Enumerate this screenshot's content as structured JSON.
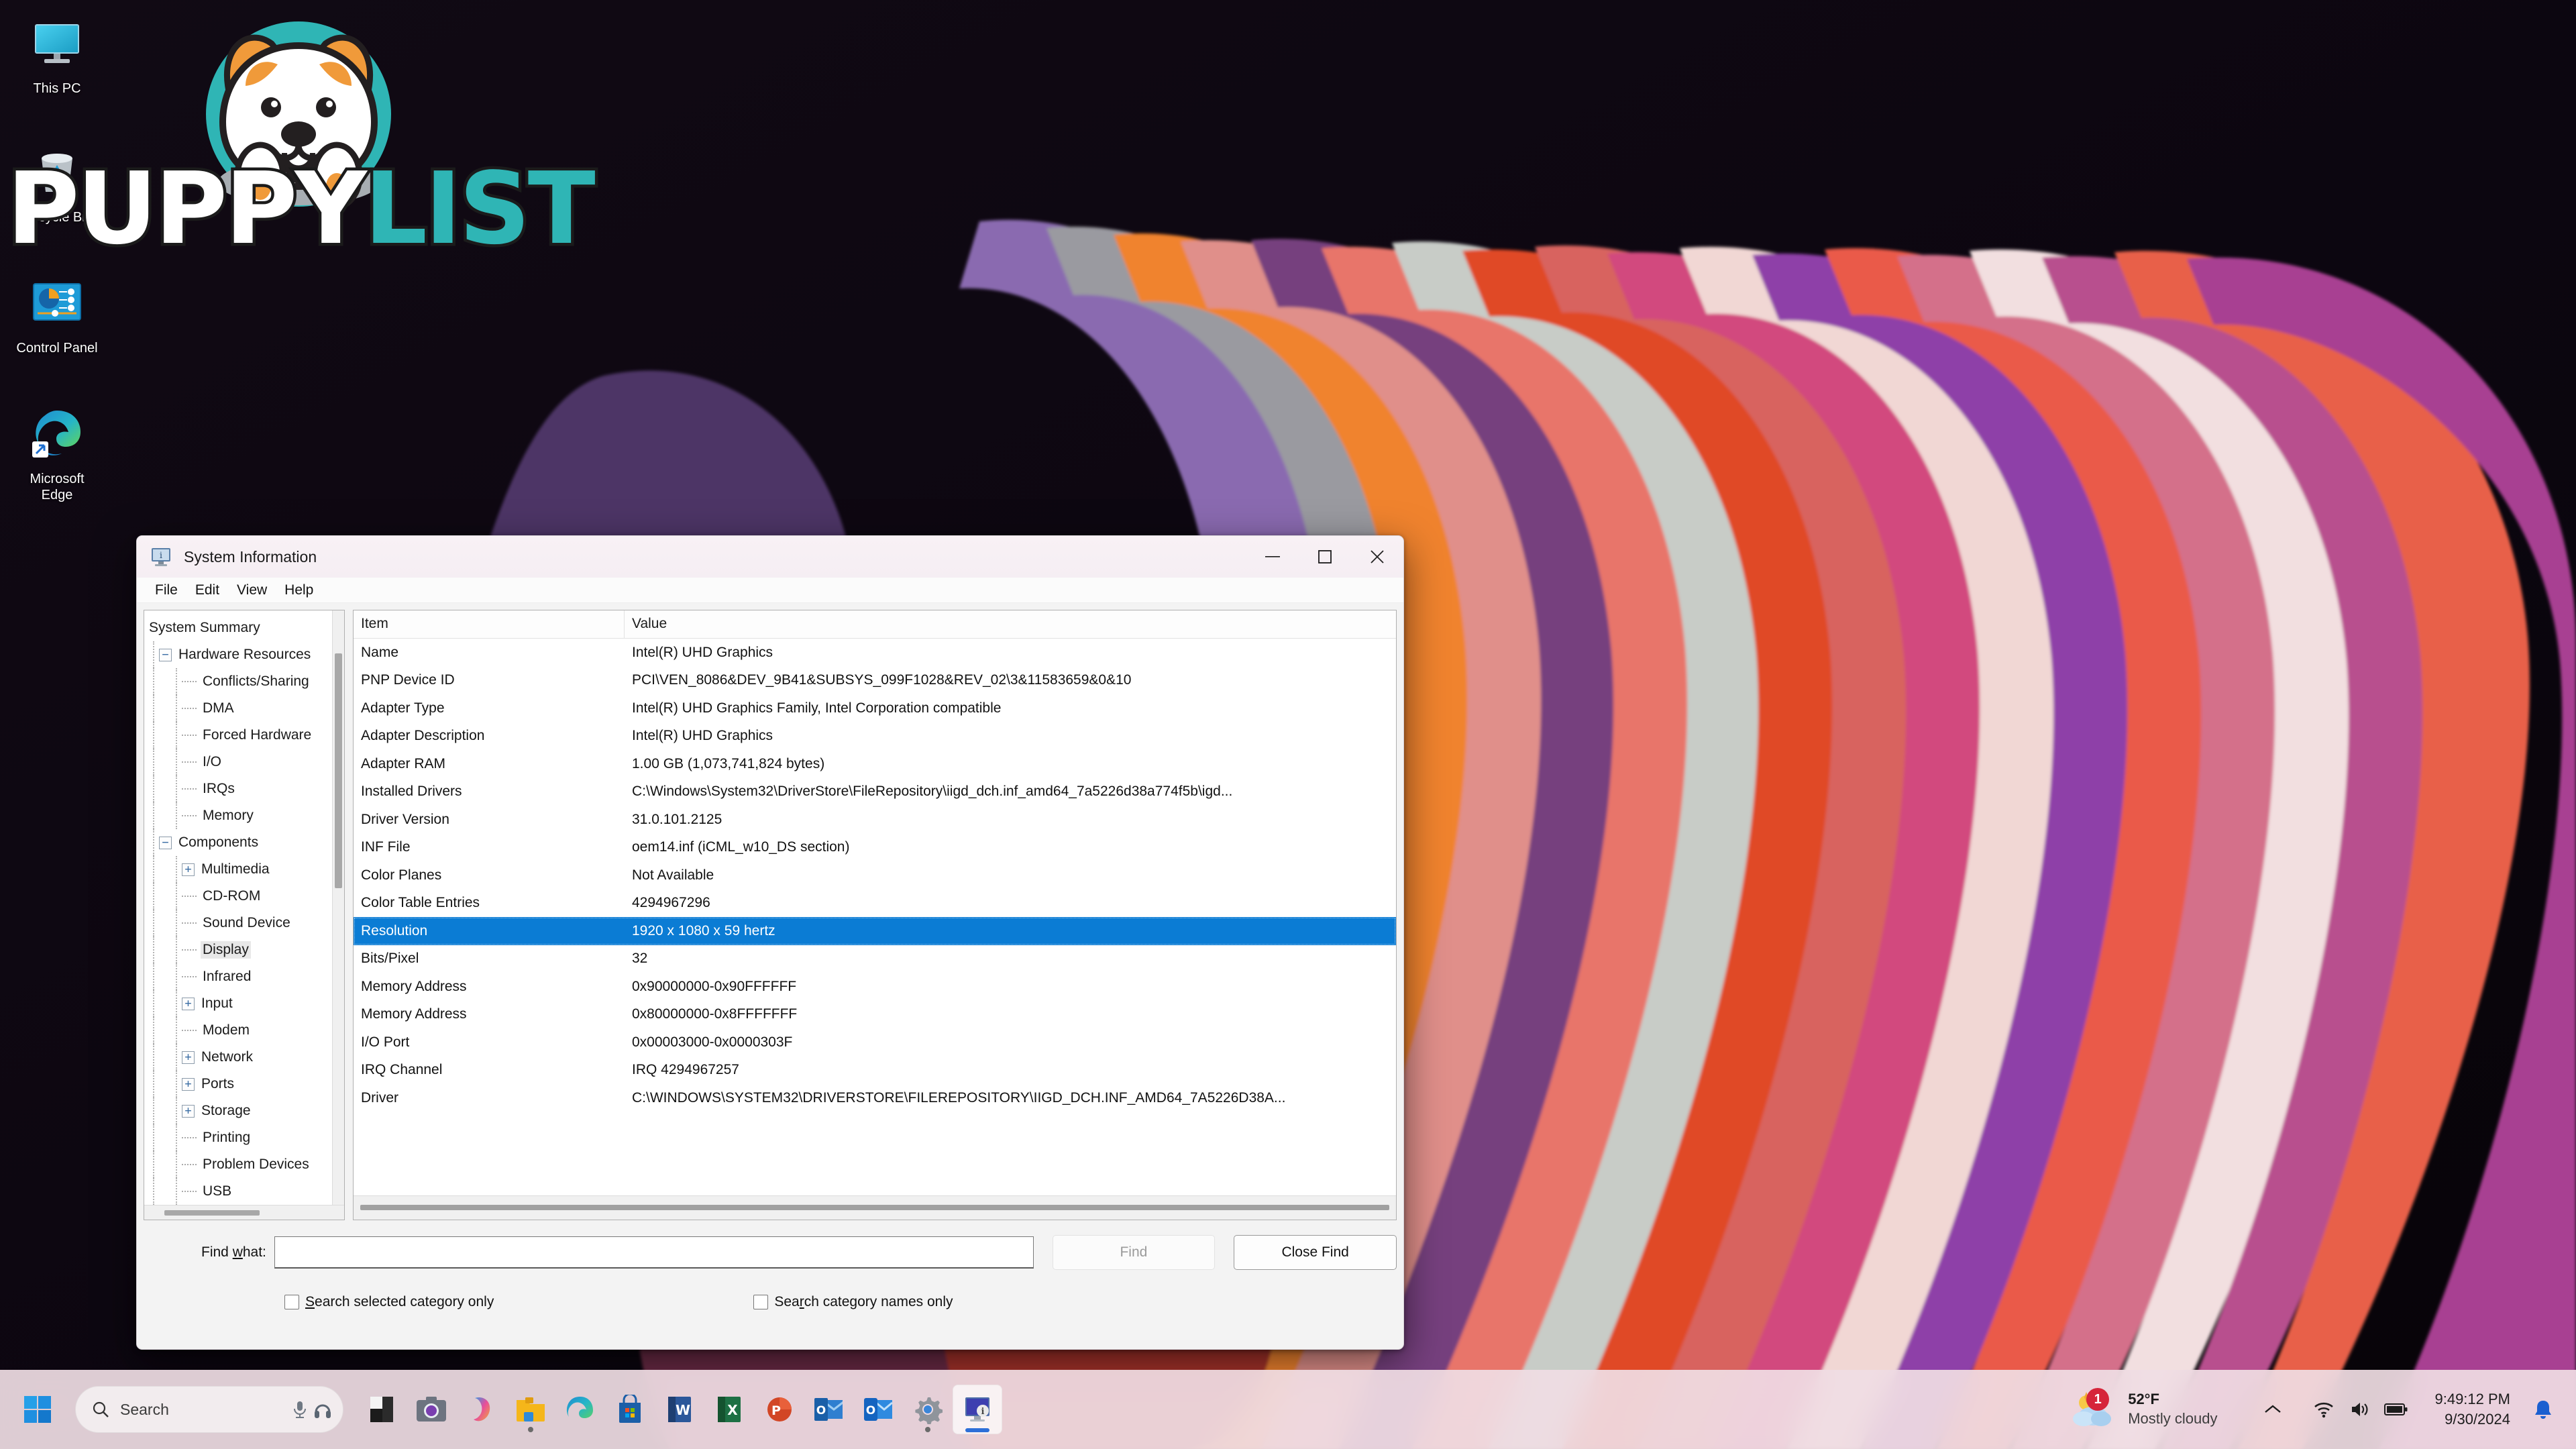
{
  "desktop": {
    "watermark": {
      "part1": "PUPPY",
      "part2": "LIST"
    },
    "icons": [
      {
        "name": "this-pc",
        "label": "This PC"
      },
      {
        "name": "recycle-bin",
        "label": "Recycle Bin"
      },
      {
        "name": "control-panel",
        "label": "Control Panel"
      },
      {
        "name": "microsoft-edge",
        "label": "Microsoft\nEdge"
      }
    ]
  },
  "window": {
    "title": "System Information",
    "icon": "system-information-icon",
    "controls": {
      "minimize": "—",
      "maximize": "□",
      "close": "✕"
    },
    "menu": [
      "File",
      "Edit",
      "View",
      "Help"
    ]
  },
  "tree": {
    "nodes": [
      {
        "label": "System Summary",
        "indent": 0,
        "toggle": "none",
        "selected": false
      },
      {
        "label": "Hardware Resources",
        "indent": 1,
        "toggle": "minus",
        "selected": false
      },
      {
        "label": "Conflicts/Sharing",
        "indent": 2,
        "toggle": "leaf",
        "selected": false
      },
      {
        "label": "DMA",
        "indent": 2,
        "toggle": "leaf",
        "selected": false
      },
      {
        "label": "Forced Hardware",
        "indent": 2,
        "toggle": "leaf",
        "selected": false
      },
      {
        "label": "I/O",
        "indent": 2,
        "toggle": "leaf",
        "selected": false
      },
      {
        "label": "IRQs",
        "indent": 2,
        "toggle": "leaf",
        "selected": false
      },
      {
        "label": "Memory",
        "indent": 2,
        "toggle": "leaf",
        "selected": false
      },
      {
        "label": "Components",
        "indent": 1,
        "toggle": "minus",
        "selected": false
      },
      {
        "label": "Multimedia",
        "indent": 2,
        "toggle": "plus",
        "selected": false
      },
      {
        "label": "CD-ROM",
        "indent": 2,
        "toggle": "leaf",
        "selected": false
      },
      {
        "label": "Sound Device",
        "indent": 2,
        "toggle": "leaf",
        "selected": false
      },
      {
        "label": "Display",
        "indent": 2,
        "toggle": "leaf",
        "selected": true
      },
      {
        "label": "Infrared",
        "indent": 2,
        "toggle": "leaf",
        "selected": false
      },
      {
        "label": "Input",
        "indent": 2,
        "toggle": "plus",
        "selected": false
      },
      {
        "label": "Modem",
        "indent": 2,
        "toggle": "leaf",
        "selected": false
      },
      {
        "label": "Network",
        "indent": 2,
        "toggle": "plus",
        "selected": false
      },
      {
        "label": "Ports",
        "indent": 2,
        "toggle": "plus",
        "selected": false
      },
      {
        "label": "Storage",
        "indent": 2,
        "toggle": "plus",
        "selected": false
      },
      {
        "label": "Printing",
        "indent": 2,
        "toggle": "leaf",
        "selected": false
      },
      {
        "label": "Problem Devices",
        "indent": 2,
        "toggle": "leaf",
        "selected": false
      },
      {
        "label": "USB",
        "indent": 2,
        "toggle": "leaf",
        "selected": false
      }
    ]
  },
  "details": {
    "columns": [
      "Item",
      "Value"
    ],
    "rows": [
      {
        "item": "Name",
        "value": "Intel(R) UHD Graphics",
        "selected": false
      },
      {
        "item": "PNP Device ID",
        "value": "PCI\\VEN_8086&DEV_9B41&SUBSYS_099F1028&REV_02\\3&11583659&0&10",
        "selected": false
      },
      {
        "item": "Adapter Type",
        "value": "Intel(R) UHD Graphics Family, Intel Corporation compatible",
        "selected": false
      },
      {
        "item": "Adapter Description",
        "value": "Intel(R) UHD Graphics",
        "selected": false
      },
      {
        "item": "Adapter RAM",
        "value": "1.00 GB (1,073,741,824 bytes)",
        "selected": false
      },
      {
        "item": "Installed Drivers",
        "value": "C:\\Windows\\System32\\DriverStore\\FileRepository\\iigd_dch.inf_amd64_7a5226d38a774f5b\\igd...",
        "selected": false
      },
      {
        "item": "Driver Version",
        "value": "31.0.101.2125",
        "selected": false
      },
      {
        "item": "INF File",
        "value": "oem14.inf (iCML_w10_DS section)",
        "selected": false
      },
      {
        "item": "Color Planes",
        "value": "Not Available",
        "selected": false
      },
      {
        "item": "Color Table Entries",
        "value": "4294967296",
        "selected": false
      },
      {
        "item": "Resolution",
        "value": "1920 x 1080 x 59 hertz",
        "selected": true
      },
      {
        "item": "Bits/Pixel",
        "value": "32",
        "selected": false
      },
      {
        "item": "Memory Address",
        "value": "0x90000000-0x90FFFFFF",
        "selected": false
      },
      {
        "item": "Memory Address",
        "value": "0x80000000-0x8FFFFFFF",
        "selected": false
      },
      {
        "item": "I/O Port",
        "value": "0x00003000-0x0000303F",
        "selected": false
      },
      {
        "item": "IRQ Channel",
        "value": "IRQ 4294967257",
        "selected": false
      },
      {
        "item": "Driver",
        "value": "C:\\WINDOWS\\SYSTEM32\\DRIVERSTORE\\FILEREPOSITORY\\IIGD_DCH.INF_AMD64_7A5226D38A...",
        "selected": false
      }
    ]
  },
  "find": {
    "label_pre": "Find ",
    "label_key": "w",
    "label_post": "hat:",
    "input_value": "",
    "input_placeholder": "",
    "find_button": "Find",
    "close_button": "Close Find",
    "checkbox1": {
      "pre": "",
      "key": "S",
      "post": "earch selected category only",
      "checked": false
    },
    "checkbox2": {
      "pre": "Sea",
      "key": "r",
      "post": "ch category names only",
      "checked": false
    }
  },
  "taskbar": {
    "start": "start-button",
    "search": {
      "placeholder": "Search",
      "icon": "search-icon"
    },
    "apps": [
      {
        "name": "lens-app",
        "running": false
      },
      {
        "name": "camera-app",
        "running": false
      },
      {
        "name": "copilot-app",
        "running": false
      },
      {
        "name": "file-explorer",
        "running": true
      },
      {
        "name": "microsoft-edge",
        "running": false
      },
      {
        "name": "microsoft-store",
        "running": false
      },
      {
        "name": "word-app",
        "running": false
      },
      {
        "name": "excel-app",
        "running": false
      },
      {
        "name": "powerpoint-app",
        "running": false
      },
      {
        "name": "outlook-classic-app",
        "running": false
      },
      {
        "name": "outlook-new-app",
        "running": false
      },
      {
        "name": "settings-app",
        "running": true
      },
      {
        "name": "system-information-app",
        "running": true,
        "active": true
      }
    ],
    "weather": {
      "temperature": "52°F",
      "description": "Mostly cloudy",
      "badge": "1"
    },
    "tray": [
      "chevron-up-icon",
      "wifi-icon",
      "volume-icon",
      "battery-icon"
    ],
    "clock": {
      "time": "9:49:12 PM",
      "date": "9/30/2024"
    },
    "notification": "bell-icon"
  },
  "colors": {
    "accent": "#0b7cd4",
    "taskbar": "#f0dde4",
    "brand_teal": "#2fb5b5",
    "window_bg": "#f3f3f3"
  }
}
